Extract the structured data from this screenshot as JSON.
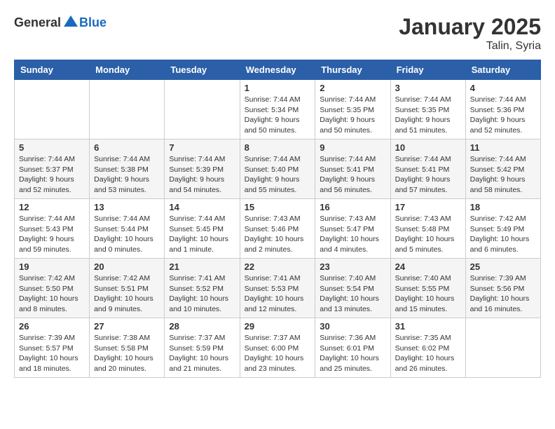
{
  "header": {
    "logo_general": "General",
    "logo_blue": "Blue",
    "month": "January 2025",
    "location": "Talin, Syria"
  },
  "weekdays": [
    "Sunday",
    "Monday",
    "Tuesday",
    "Wednesday",
    "Thursday",
    "Friday",
    "Saturday"
  ],
  "weeks": [
    [
      {
        "day": "",
        "info": ""
      },
      {
        "day": "",
        "info": ""
      },
      {
        "day": "",
        "info": ""
      },
      {
        "day": "1",
        "info": "Sunrise: 7:44 AM\nSunset: 5:34 PM\nDaylight: 9 hours\nand 50 minutes."
      },
      {
        "day": "2",
        "info": "Sunrise: 7:44 AM\nSunset: 5:35 PM\nDaylight: 9 hours\nand 50 minutes."
      },
      {
        "day": "3",
        "info": "Sunrise: 7:44 AM\nSunset: 5:35 PM\nDaylight: 9 hours\nand 51 minutes."
      },
      {
        "day": "4",
        "info": "Sunrise: 7:44 AM\nSunset: 5:36 PM\nDaylight: 9 hours\nand 52 minutes."
      }
    ],
    [
      {
        "day": "5",
        "info": "Sunrise: 7:44 AM\nSunset: 5:37 PM\nDaylight: 9 hours\nand 52 minutes."
      },
      {
        "day": "6",
        "info": "Sunrise: 7:44 AM\nSunset: 5:38 PM\nDaylight: 9 hours\nand 53 minutes."
      },
      {
        "day": "7",
        "info": "Sunrise: 7:44 AM\nSunset: 5:39 PM\nDaylight: 9 hours\nand 54 minutes."
      },
      {
        "day": "8",
        "info": "Sunrise: 7:44 AM\nSunset: 5:40 PM\nDaylight: 9 hours\nand 55 minutes."
      },
      {
        "day": "9",
        "info": "Sunrise: 7:44 AM\nSunset: 5:41 PM\nDaylight: 9 hours\nand 56 minutes."
      },
      {
        "day": "10",
        "info": "Sunrise: 7:44 AM\nSunset: 5:41 PM\nDaylight: 9 hours\nand 57 minutes."
      },
      {
        "day": "11",
        "info": "Sunrise: 7:44 AM\nSunset: 5:42 PM\nDaylight: 9 hours\nand 58 minutes."
      }
    ],
    [
      {
        "day": "12",
        "info": "Sunrise: 7:44 AM\nSunset: 5:43 PM\nDaylight: 9 hours\nand 59 minutes."
      },
      {
        "day": "13",
        "info": "Sunrise: 7:44 AM\nSunset: 5:44 PM\nDaylight: 10 hours\nand 0 minutes."
      },
      {
        "day": "14",
        "info": "Sunrise: 7:44 AM\nSunset: 5:45 PM\nDaylight: 10 hours\nand 1 minute."
      },
      {
        "day": "15",
        "info": "Sunrise: 7:43 AM\nSunset: 5:46 PM\nDaylight: 10 hours\nand 2 minutes."
      },
      {
        "day": "16",
        "info": "Sunrise: 7:43 AM\nSunset: 5:47 PM\nDaylight: 10 hours\nand 4 minutes."
      },
      {
        "day": "17",
        "info": "Sunrise: 7:43 AM\nSunset: 5:48 PM\nDaylight: 10 hours\nand 5 minutes."
      },
      {
        "day": "18",
        "info": "Sunrise: 7:42 AM\nSunset: 5:49 PM\nDaylight: 10 hours\nand 6 minutes."
      }
    ],
    [
      {
        "day": "19",
        "info": "Sunrise: 7:42 AM\nSunset: 5:50 PM\nDaylight: 10 hours\nand 8 minutes."
      },
      {
        "day": "20",
        "info": "Sunrise: 7:42 AM\nSunset: 5:51 PM\nDaylight: 10 hours\nand 9 minutes."
      },
      {
        "day": "21",
        "info": "Sunrise: 7:41 AM\nSunset: 5:52 PM\nDaylight: 10 hours\nand 10 minutes."
      },
      {
        "day": "22",
        "info": "Sunrise: 7:41 AM\nSunset: 5:53 PM\nDaylight: 10 hours\nand 12 minutes."
      },
      {
        "day": "23",
        "info": "Sunrise: 7:40 AM\nSunset: 5:54 PM\nDaylight: 10 hours\nand 13 minutes."
      },
      {
        "day": "24",
        "info": "Sunrise: 7:40 AM\nSunset: 5:55 PM\nDaylight: 10 hours\nand 15 minutes."
      },
      {
        "day": "25",
        "info": "Sunrise: 7:39 AM\nSunset: 5:56 PM\nDaylight: 10 hours\nand 16 minutes."
      }
    ],
    [
      {
        "day": "26",
        "info": "Sunrise: 7:39 AM\nSunset: 5:57 PM\nDaylight: 10 hours\nand 18 minutes."
      },
      {
        "day": "27",
        "info": "Sunrise: 7:38 AM\nSunset: 5:58 PM\nDaylight: 10 hours\nand 20 minutes."
      },
      {
        "day": "28",
        "info": "Sunrise: 7:37 AM\nSunset: 5:59 PM\nDaylight: 10 hours\nand 21 minutes."
      },
      {
        "day": "29",
        "info": "Sunrise: 7:37 AM\nSunset: 6:00 PM\nDaylight: 10 hours\nand 23 minutes."
      },
      {
        "day": "30",
        "info": "Sunrise: 7:36 AM\nSunset: 6:01 PM\nDaylight: 10 hours\nand 25 minutes."
      },
      {
        "day": "31",
        "info": "Sunrise: 7:35 AM\nSunset: 6:02 PM\nDaylight: 10 hours\nand 26 minutes."
      },
      {
        "day": "",
        "info": ""
      }
    ]
  ]
}
